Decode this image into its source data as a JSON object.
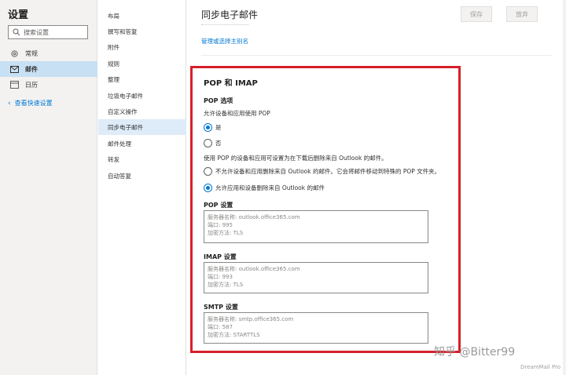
{
  "left_pane": {
    "title": "设置",
    "search_placeholder": "搜索设置",
    "items": [
      {
        "label": "常规",
        "icon": "gear-icon"
      },
      {
        "label": "邮件",
        "icon": "mail-icon"
      },
      {
        "label": "日历",
        "icon": "calendar-icon"
      }
    ],
    "quick_settings_link": "查看快速设置"
  },
  "mid_nav": {
    "items": [
      "布局",
      "撰写和答复",
      "附件",
      "规则",
      "整理",
      "垃圾电子邮件",
      "自定义操作",
      "同步电子邮件",
      "邮件处理",
      "转发",
      "自动答复"
    ],
    "active_index": 7
  },
  "main": {
    "title": "同步电子邮件",
    "save_label": "保存",
    "discard_label": "放弃",
    "alias_link": "管理或选择主别名",
    "pop_imap": {
      "heading": "POP 和 IMAP",
      "pop_options_label": "POP 选项",
      "allow_pop_text": "允许设备和应用使用 POP",
      "yes_label": "是",
      "no_label": "否",
      "pop_delete_text": "使用 POP 的设备和应用可设置为在下载后删除来自 Outlook 的邮件。",
      "dont_allow_delete_label": "不允许设备和应用删除来自 Outlook 的邮件。它会将邮件移动到特殊的 POP 文件夹。",
      "allow_delete_label": "允许应用和设备删除来自 Outlook 的邮件",
      "pop_settings_label": "POP 设置",
      "pop_settings": {
        "server": "服务器名称: outlook.office365.com",
        "port": "端口: 995",
        "encryption": "加密方法: TLS"
      },
      "imap_settings_label": "IMAP 设置",
      "imap_settings": {
        "server": "服务器名称: outlook.office365.com",
        "port": "端口: 993",
        "encryption": "加密方法: TLS"
      },
      "smtp_settings_label": "SMTP 设置",
      "smtp_settings": {
        "server": "服务器名称: smtp.office365.com",
        "port": "端口: 587",
        "encryption": "加密方法: STARTTLS"
      }
    }
  },
  "watermark": "知乎 @Bitter99",
  "brand": "DreamMail Pro",
  "colors": {
    "accent": "#0078d4",
    "highlight_border": "#d6202a",
    "active_nav": "#c7e0f4"
  }
}
